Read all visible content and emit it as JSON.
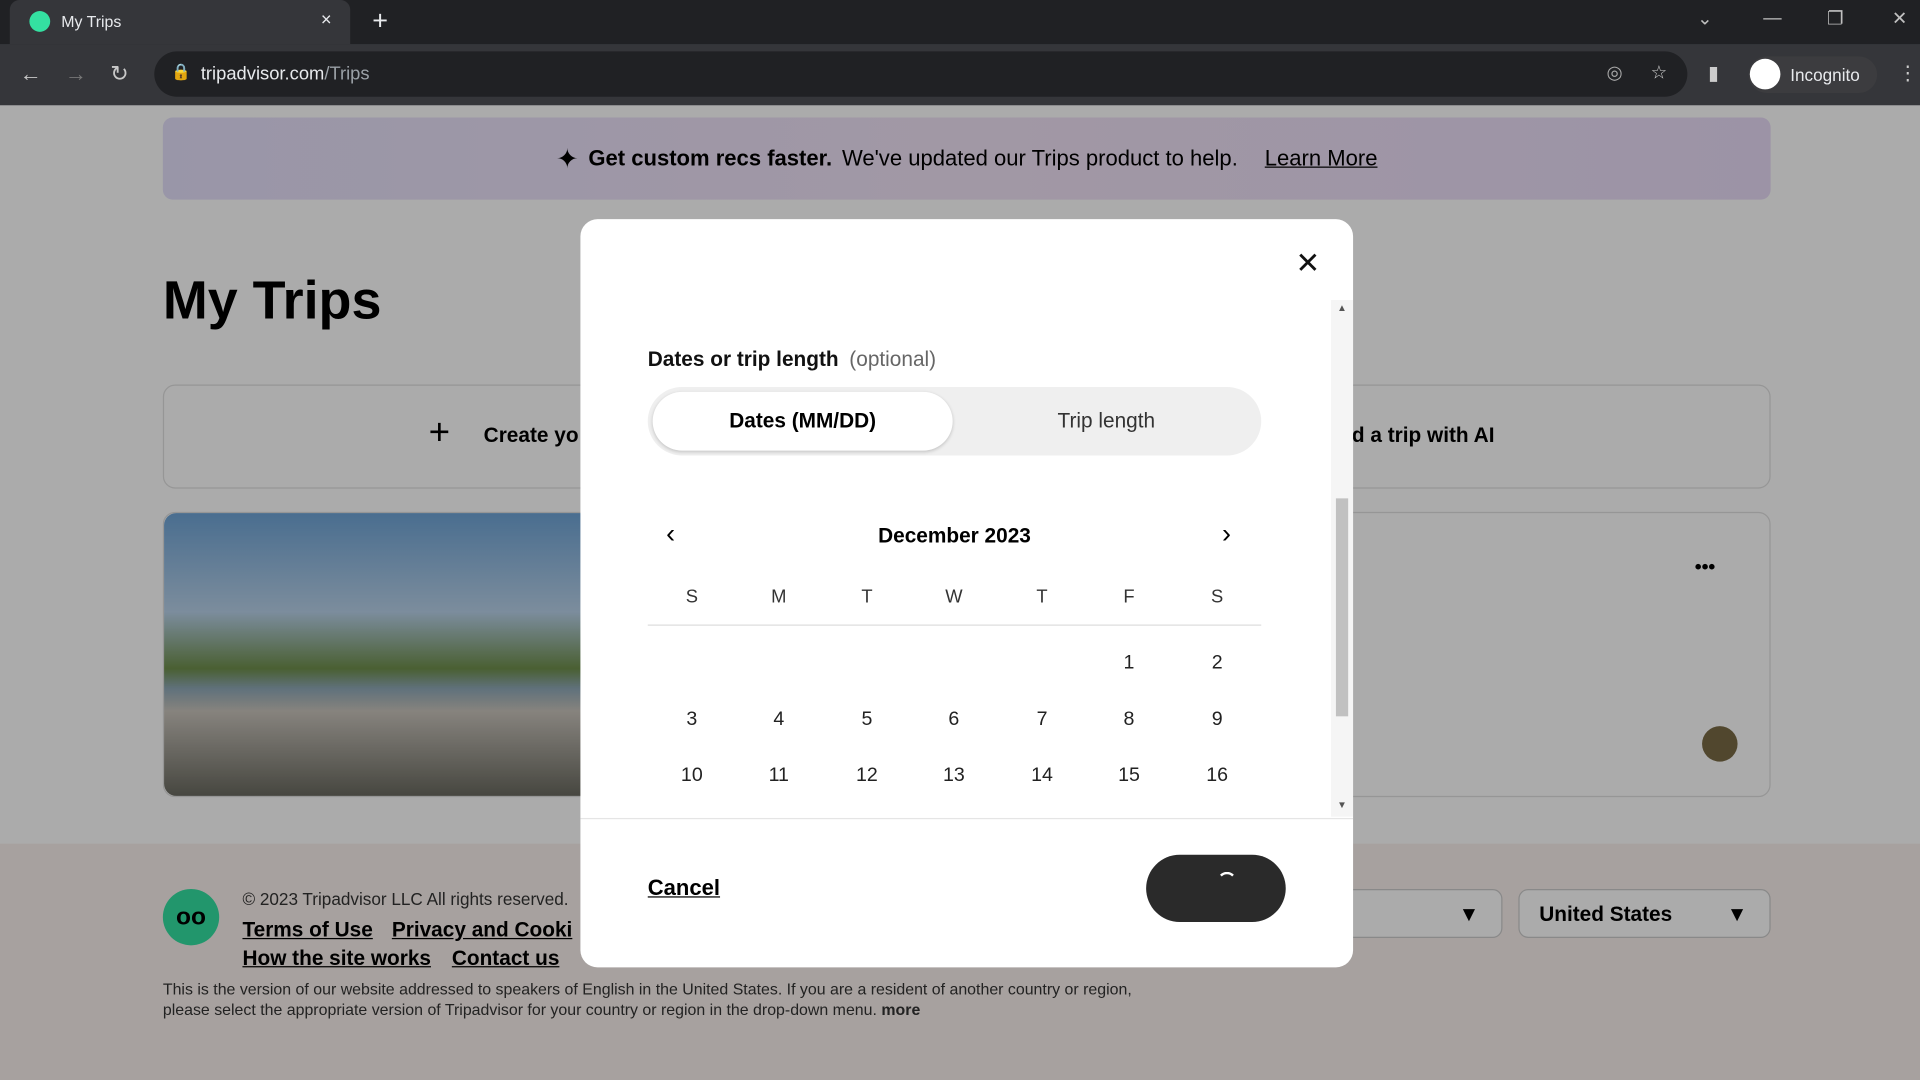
{
  "browser": {
    "tab_title": "My Trips",
    "tab_close": "×",
    "new_tab": "+",
    "url_domain": "tripadvisor.com",
    "url_path": "/Trips",
    "profile": "Incognito"
  },
  "banner": {
    "bold": "Get custom recs faster.",
    "text": "We've updated our Trips product to help.",
    "link": "Learn More"
  },
  "page": {
    "title": "My Trips",
    "create_label": "Create yo",
    "ai_label": "d a trip with AI",
    "more": "•••"
  },
  "footer": {
    "copyright": "© 2023 Tripadvisor LLC All rights reserved.",
    "links": [
      "Terms of Use",
      "Privacy and Cooki",
      "How the site works",
      "Contact us"
    ],
    "notice_1": "This is the version of our website addressed to speakers of English in the United States. If you are a resident of another country or region,",
    "notice_2": "please select the appropriate version of Tripadvisor for your country or region in the drop-down menu.",
    "more": "more",
    "region": "United States"
  },
  "modal": {
    "label": "Dates or trip length",
    "optional": "(optional)",
    "tabs": [
      "Dates (MM/DD)",
      "Trip length"
    ],
    "active_tab": "Dates (MM/DD)",
    "month": "December 2023",
    "weekdays": [
      "S",
      "M",
      "T",
      "W",
      "T",
      "F",
      "S"
    ],
    "weeks": [
      [
        "",
        "",
        "",
        "",
        "",
        "1",
        "2"
      ],
      [
        "3",
        "4",
        "5",
        "6",
        "7",
        "8",
        "9"
      ],
      [
        "10",
        "11",
        "12",
        "13",
        "14",
        "15",
        "16"
      ]
    ],
    "cancel": "Cancel",
    "submit_state": "loading"
  }
}
